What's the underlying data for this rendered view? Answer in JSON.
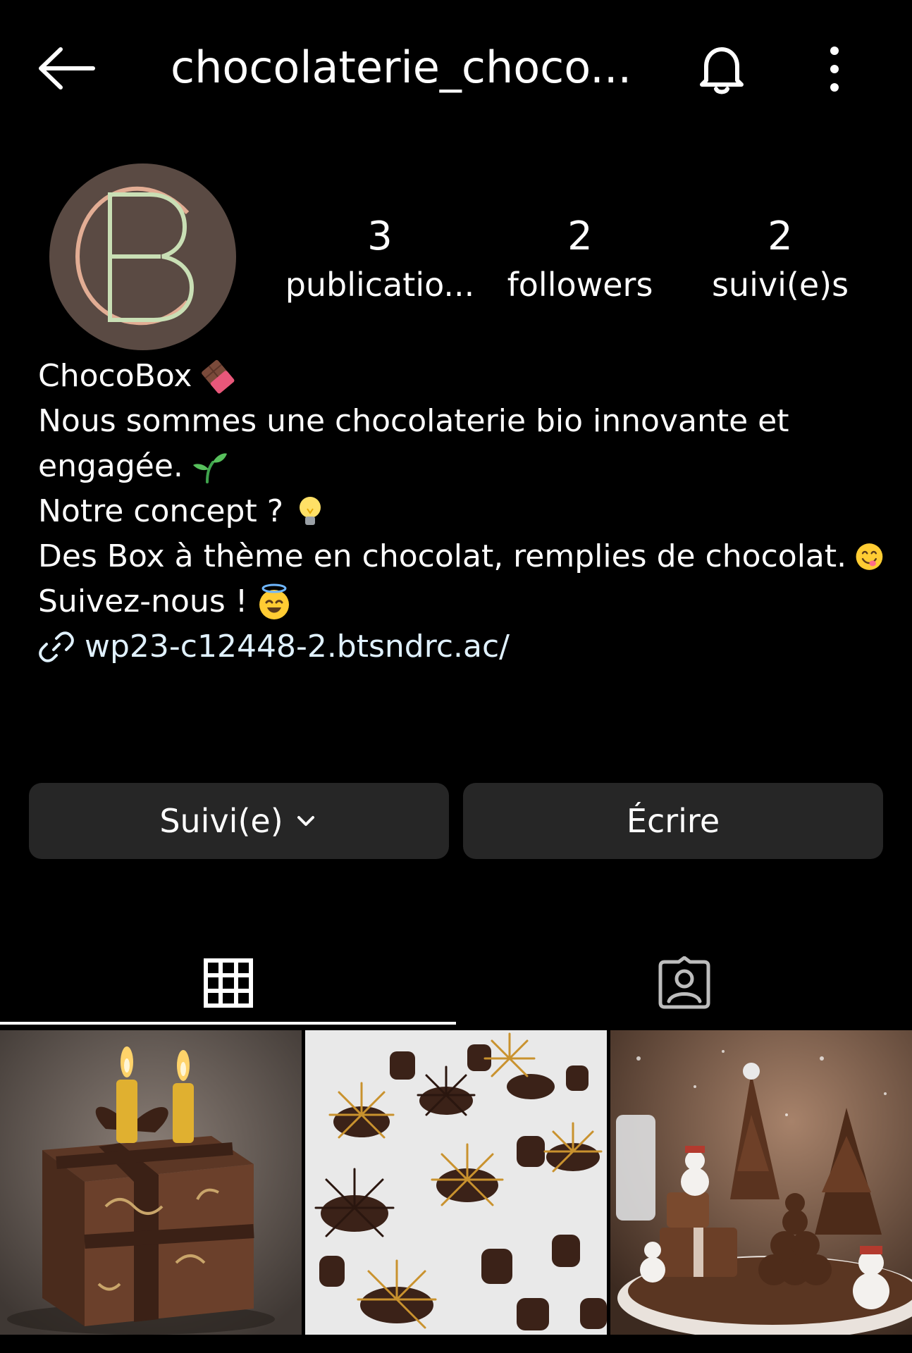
{
  "header": {
    "title": "chocolaterie_choco...",
    "back_icon": "arrow-left-icon",
    "bell_icon": "bell-icon",
    "more_icon": "more-vertical-icon"
  },
  "profile": {
    "avatar_letters": "CB",
    "stats": [
      {
        "value": "3",
        "label": "publicatio..."
      },
      {
        "value": "2",
        "label": "followers"
      },
      {
        "value": "2",
        "label": "suivi(e)s"
      }
    ]
  },
  "bio": {
    "name": "ChocoBox",
    "line1": "Nous sommes une chocolaterie bio innovante et",
    "line2": "engagée.",
    "line3": "Notre concept ?",
    "line4": "Des Box à thème en chocolat, remplies de chocolat.",
    "line5": "Suivez-nous !",
    "link": "wp23-c12448-2.btsndrc.ac/"
  },
  "actions": {
    "follow_label": "Suivi(e)",
    "message_label": "Écrire"
  },
  "tabs": [
    {
      "name": "posts-grid",
      "icon": "grid-icon",
      "active": true
    },
    {
      "name": "tagged",
      "icon": "tagged-person-icon",
      "active": false
    }
  ],
  "colors": {
    "background": "#000000",
    "button_bg": "#262626",
    "link": "#e0f1ff",
    "avatar_bg": "#5a4a43"
  }
}
